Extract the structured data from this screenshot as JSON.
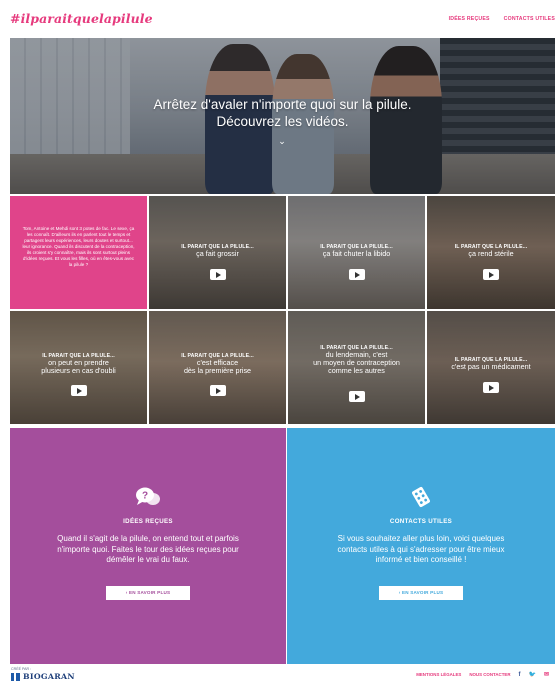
{
  "header": {
    "logo": "#ilparaitquelapilule",
    "nav": [
      "IDÉES REÇUES",
      "CONTACTS UTILES"
    ]
  },
  "hero": {
    "line1": "Arrêtez d'avaler n'importe quoi sur la pilule.",
    "line2": "Découvrez les vidéos.",
    "chevron": "⌄"
  },
  "intro": {
    "text": "Tom, Antoine et Mehdi sont 3 potes de fac. Le sexe, ça les connaît. D'ailleurs ils en parlent tout le temps et partagent leurs expériences, leurs doutes et surtout... leur ignorance. Quand ils discutent de la contraception, ils croient s'y connaître, mais ils sont surtout pleins d'idées reçues. Et vous les filles, où en êtes-vous avec la pilule ?"
  },
  "videos": [
    {
      "kicker": "IL PARAIT QUE LA PILULE...",
      "lines": [
        "ça fait grossir"
      ]
    },
    {
      "kicker": "IL PARAIT QUE LA PILULE...",
      "lines": [
        "ça fait chuter la libido"
      ]
    },
    {
      "kicker": "IL PARAIT QUE LA PILULE...",
      "lines": [
        "ça rend stérile"
      ]
    },
    {
      "kicker": "IL PARAIT QUE LA PILULE...",
      "lines": [
        "on peut en prendre",
        "plusieurs en cas d'oubli"
      ]
    },
    {
      "kicker": "IL PARAIT QUE LA PILULE...",
      "lines": [
        "c'est efficace",
        "dès la première prise"
      ]
    },
    {
      "kicker": "IL PARAIT QUE LA PILULE...",
      "lines": [
        "du lendemain, c'est",
        "un moyen de contraception",
        "comme les autres"
      ]
    },
    {
      "kicker": "IL PARAIT QUE LA PILULE...",
      "lines": [
        "c'est pas un médicament"
      ]
    }
  ],
  "panels": {
    "left": {
      "icon": "speech-question-icon",
      "title": "IDÉES REÇUES",
      "text": "Quand il s'agit de la pilule, on entend tout et parfois n'importe quoi. Faites le tour des idées reçues pour démêler le vrai du faux.",
      "button": "›  EN SAVOIR PLUS",
      "color": "#a44e9c"
    },
    "right": {
      "icon": "pill-pack-icon",
      "title": "CONTACTS UTILES",
      "text": "Si vous souhaitez aller plus loin, voici quelques contacts utiles à qui s'adresser pour être mieux informé et bien conseillé !",
      "button": "›  EN SAVOIR PLUS",
      "color": "#43a9dc"
    }
  },
  "footer": {
    "small": "CRÉÉ PAR :",
    "brand": "BIOGARAN",
    "links": [
      "MENTIONS LÉGALES",
      "NOUS CONTACTER"
    ],
    "social": [
      "f",
      "🐦",
      "✉"
    ]
  },
  "colors": {
    "accent": "#e63a7d",
    "intro_bg": "#e0448a",
    "purple": "#a44e9c",
    "blue": "#43a9dc"
  }
}
